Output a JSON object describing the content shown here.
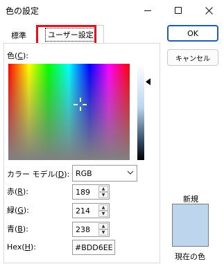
{
  "window": {
    "title": "色の設定",
    "minimize_icon": "minimize-icon",
    "maximize_icon": "maximize-icon",
    "close_icon": "close-icon"
  },
  "tabs": [
    {
      "label": "標準"
    },
    {
      "label": "ユーザー設定",
      "selected": true
    }
  ],
  "accent_highlight_color": "#e5101b",
  "color_label": {
    "text": "色(",
    "key": "C",
    "suffix": "):"
  },
  "model": {
    "label_text": "カラー モデル(",
    "key": "D",
    "suffix": "):",
    "value": "RGB"
  },
  "red": {
    "label_text": "赤(",
    "key": "R",
    "suffix": "):",
    "value": "189"
  },
  "green": {
    "label_text": "緑(",
    "key": "G",
    "suffix": "):",
    "value": "214"
  },
  "blue": {
    "label_text": "青(",
    "key": "B",
    "suffix": "):",
    "value": "238"
  },
  "hex": {
    "label_text": "Hex(",
    "key": "H",
    "suffix": "):",
    "value": "#BDD6EE"
  },
  "buttons": {
    "ok": "OK",
    "cancel": "キャンセル"
  },
  "preview": {
    "new_label": "新規",
    "current_label": "現在の色",
    "color": "#BDD6EE"
  }
}
